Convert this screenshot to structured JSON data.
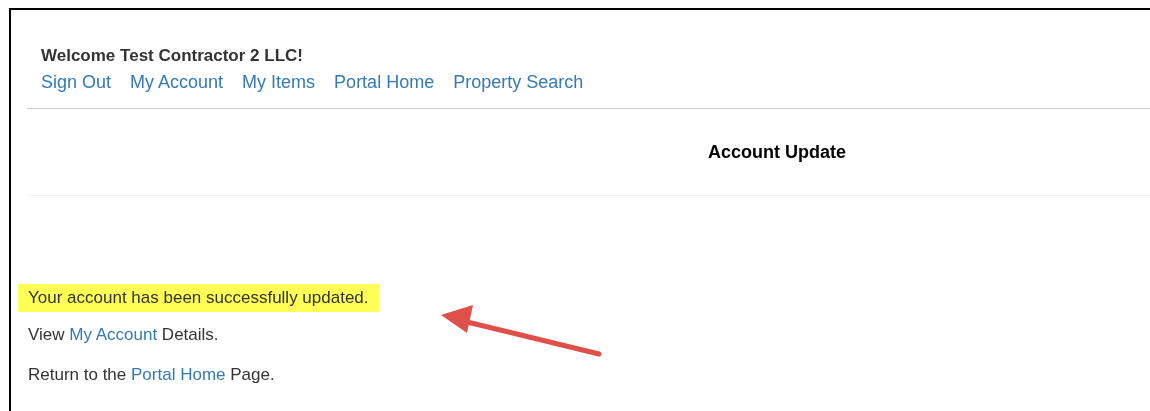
{
  "welcome": "Welcome Test Contractor 2 LLC!",
  "nav_links": [
    "Sign Out",
    "My Account",
    "My Items",
    "Portal Home",
    "Property Search"
  ],
  "heading": "Account Update",
  "message": {
    "text": "Your account has been successfully updated.",
    "highlighted": true
  },
  "lines": [
    {
      "before": "View ",
      "link": "My Account",
      "after": " Details."
    },
    {
      "before": "Return to the ",
      "link": "Portal Home",
      "after": " Page."
    }
  ]
}
